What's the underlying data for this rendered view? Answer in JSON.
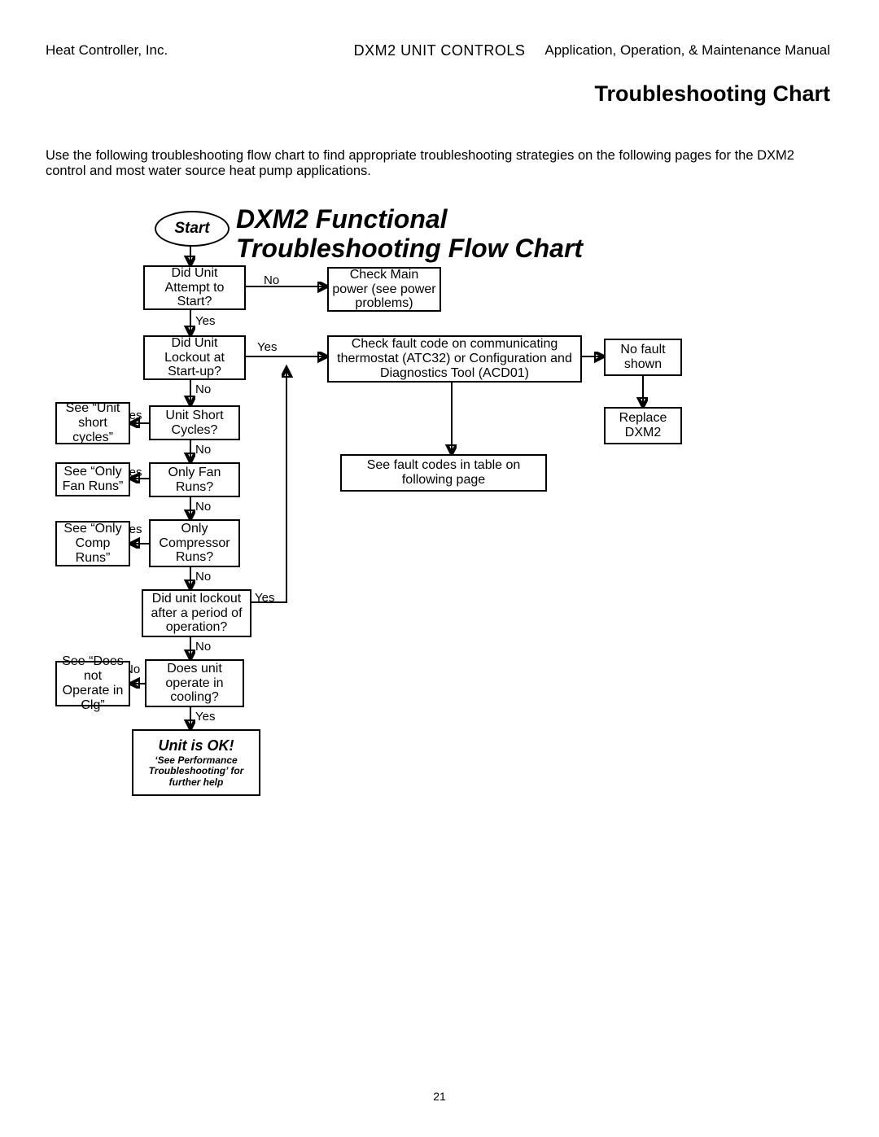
{
  "header": {
    "left": "Heat Controller, Inc.",
    "center": "DXM2 UNIT CONTROLS",
    "right": "Application, Operation, & Maintenance Manual"
  },
  "section_title": "Troubleshooting Chart",
  "intro": "Use the following troubleshooting flow chart to find appropriate troubleshooting strategies on the following pages for the DXM2 control and most water source heat pump applications.",
  "chart_title_line1": "DXM2  Functional",
  "chart_title_line2": "Troubleshooting Flow Chart",
  "start": "Start",
  "nodes": {
    "q_start": "Did Unit Attempt to Start?",
    "check_power": "Check Main power (see power problems)",
    "q_lockout_startup": "Did Unit Lockout at Start-up?",
    "check_fault": "Check fault code on communicating thermostat (ATC32) or Configuration and Diagnostics Tool (ACD01)",
    "no_fault": "No fault shown",
    "replace": "Replace DXM2",
    "see_faults": "See fault codes in table on following page",
    "q_short": "Unit Short Cycles?",
    "see_short": "See “Unit short cycles”",
    "q_fan": "Only Fan Runs?",
    "see_fan": "See “Only Fan Runs”",
    "q_comp": "Only Compressor Runs?",
    "see_comp": "See “Only Comp Runs”",
    "q_lockout_op": "Did unit lockout after a period of operation?",
    "q_cooling": "Does unit operate in cooling?",
    "see_clg": "See “Does not Operate in Clg”",
    "end_title": "Unit is OK!",
    "end_sub": "‘See Performance Troubleshooting’ for further help"
  },
  "labels": {
    "yes": "Yes",
    "no": "No"
  },
  "page_number": "21"
}
